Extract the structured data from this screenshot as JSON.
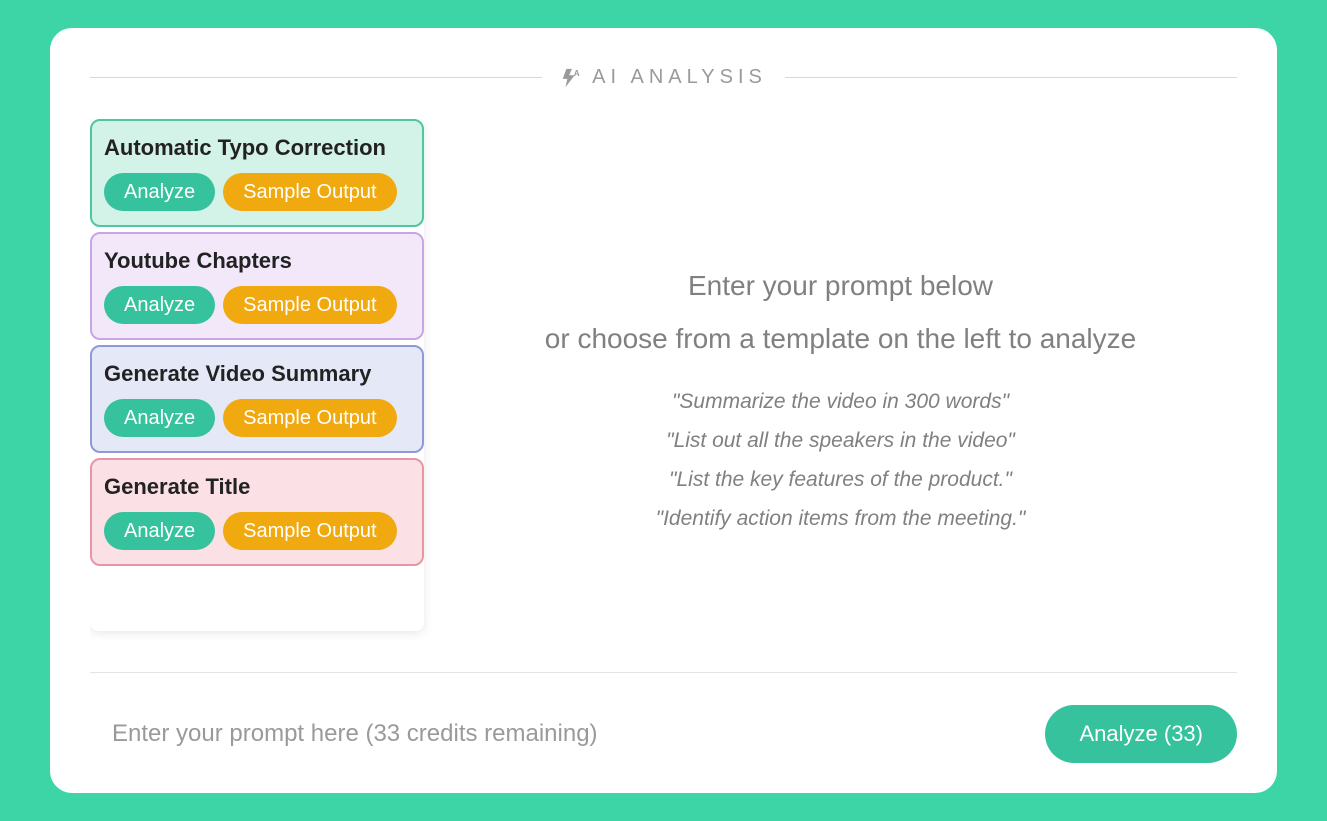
{
  "header": {
    "title": "AI ANALYSIS"
  },
  "templates": [
    {
      "title": "Automatic Typo Correction",
      "analyze": "Analyze",
      "sample": "Sample Output",
      "variant": "green"
    },
    {
      "title": "Youtube Chapters",
      "analyze": "Analyze",
      "sample": "Sample Output",
      "variant": "purple"
    },
    {
      "title": "Generate Video Summary",
      "analyze": "Analyze",
      "sample": "Sample Output",
      "variant": "blue"
    },
    {
      "title": "Generate Title",
      "analyze": "Analyze",
      "sample": "Sample Output",
      "variant": "pink"
    }
  ],
  "instructions": {
    "line1": "Enter your prompt below",
    "line2": "or choose from a template on the left to analyze",
    "examples": [
      "\"Summarize the video in 300 words\"",
      "\"List out all the speakers in the video\"",
      "\"List the key features of the product.\"",
      "\"Identify action items from the meeting.\""
    ]
  },
  "footer": {
    "placeholder": "Enter your prompt here (33 credits remaining)",
    "analyze_label": "Analyze (33)",
    "credits": 33
  }
}
